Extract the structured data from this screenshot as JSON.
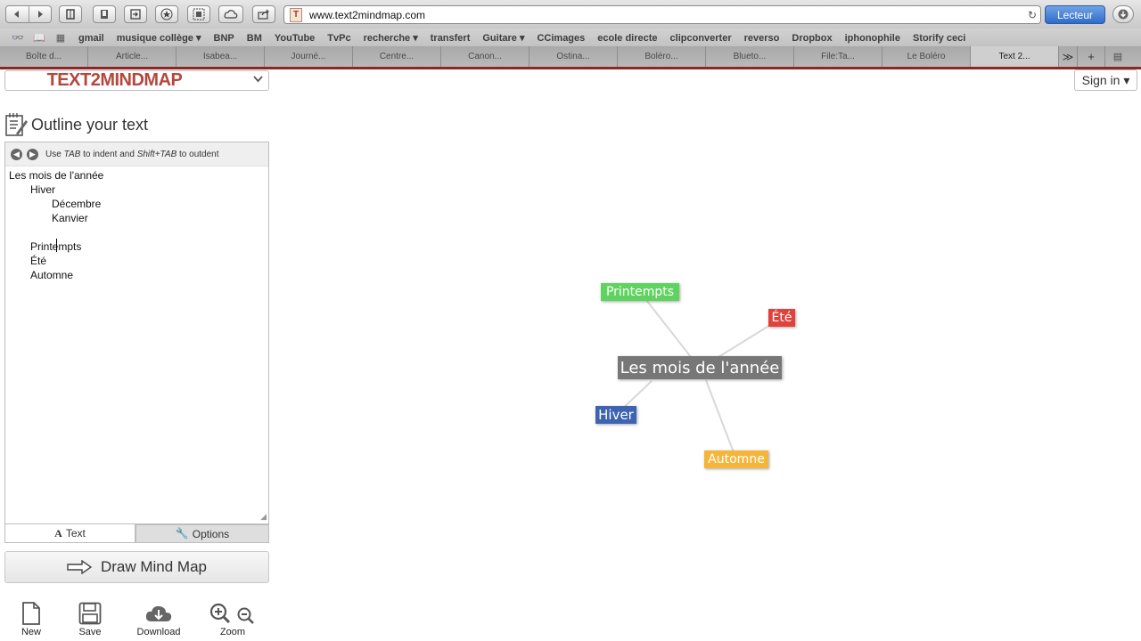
{
  "browser": {
    "url": "www.text2mindmap.com",
    "reader_label": "Lecteur",
    "bookmarks": [
      "gmail",
      "musique collège ▾",
      "BNP",
      "BM",
      "YouTube",
      "TvPc",
      "recherche ▾",
      "transfert",
      "Guitare ▾",
      "CCimages",
      "ecole directe",
      "clipconverter",
      "reverso",
      "Dropbox",
      "iphonophile",
      "Storify ceci"
    ],
    "tabs": [
      "Boîte d...",
      "Article...",
      "Isabea...",
      "Journé...",
      "Centre...",
      "Canon...",
      "Ostina...",
      "Boléro...",
      "Blueto...",
      "File:Ta...",
      "Le Boléro",
      "Text 2..."
    ],
    "tabs_more": "≫",
    "new_tab": "+"
  },
  "app": {
    "logo": "TEXT2MINDMAP",
    "sign_in": "Sign in ▾",
    "outline_title": "Outline your text",
    "help": {
      "use": "Use",
      "tab": "TAB",
      "indent": "to indent and",
      "shift_tab": "Shift+TAB",
      "outdent": "to outdent"
    },
    "outline_lines": [
      {
        "text": "Les mois de l'année",
        "level": 0
      },
      {
        "text": "Hiver",
        "level": 1
      },
      {
        "text": "Décembre",
        "level": 2
      },
      {
        "text": "Kanvier",
        "level": 2
      },
      {
        "text": "",
        "level": 2
      },
      {
        "text": "Printempts",
        "level": 1
      },
      {
        "text": "Été",
        "level": 1
      },
      {
        "text": "Automne",
        "level": 1
      }
    ],
    "tab_text": "Text",
    "tab_options": "Options",
    "draw_button": "Draw Mind Map",
    "tools": {
      "new": "New",
      "save": "Save",
      "download": "Download",
      "zoom": "Zoom"
    }
  },
  "mindmap": {
    "center": {
      "label": "Les mois de l'année",
      "color": "#777777"
    },
    "branches": [
      {
        "label": "Printempts",
        "color": "#5fd35f"
      },
      {
        "label": "Été",
        "color": "#e0413b"
      },
      {
        "label": "Hiver",
        "color": "#3e63b0"
      },
      {
        "label": "Automne",
        "color": "#f5b53a"
      }
    ]
  }
}
